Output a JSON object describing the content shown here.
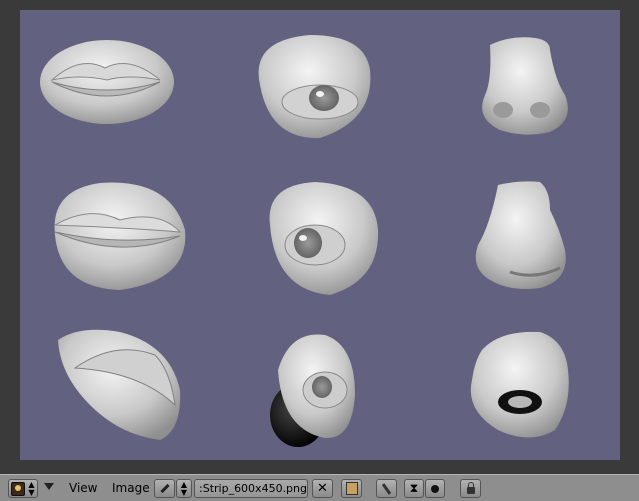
{
  "header": {
    "editor_type_icon": "image-editor-icon",
    "menus": [
      {
        "label": "View"
      },
      {
        "label": "Image"
      }
    ],
    "image_browse_icon": "pin-icon",
    "image_name": ":Strip_600x450.png",
    "unlink_icon": "close-icon",
    "pack_icon": "package-icon",
    "paint_icon": "brush-icon",
    "lock_icon": "lock-icon"
  },
  "viewport": {
    "background_color": "#626180",
    "image_name": "Strip_600x450.png"
  }
}
